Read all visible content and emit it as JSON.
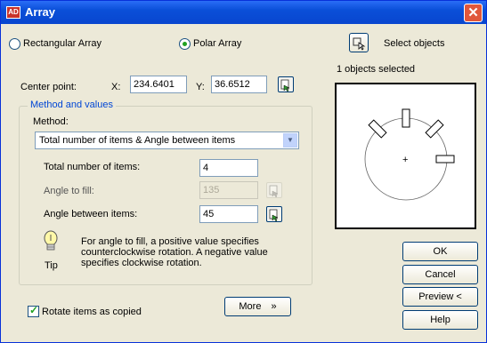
{
  "window": {
    "app_icon_text": "AD",
    "title": "Array",
    "close_symbol": "✕"
  },
  "array_type": {
    "rectangular_label": "Rectangular Array",
    "polar_label": "Polar Array",
    "selected": "Polar Array"
  },
  "center_point": {
    "label": "Center point:",
    "x_label": "X:",
    "x_value": "234.6401",
    "y_label": "Y:",
    "y_value": "36.6512"
  },
  "method_values": {
    "legend": "Method and values",
    "method_label": "Method:",
    "method_value": "Total number of items & Angle between items",
    "total_items_label": "Total number of items:",
    "total_items_value": "4",
    "angle_fill_label": "Angle to fill:",
    "angle_fill_value": "135",
    "angle_between_label": "Angle between items:",
    "angle_between_value": "45",
    "tip_text": "For angle to fill, a positive value specifies counterclockwise rotation.  A negative value specifies clockwise rotation.",
    "tip_label": "Tip"
  },
  "options": {
    "rotate_label": "Rotate items as copied",
    "rotate_checked": true,
    "more_label": "More",
    "more_chevron": "»"
  },
  "selection": {
    "select_objects_label": "Select objects",
    "count_text": "1 objects selected"
  },
  "buttons": {
    "ok": "OK",
    "cancel": "Cancel",
    "preview": "Preview <",
    "help": "Help"
  },
  "icons": {
    "pick_point": "pick-point-icon",
    "select_objects": "select-objects-icon",
    "lightbulb": "lightbulb-icon"
  },
  "colors": {
    "titlebar": "#0a4fd8",
    "dialog_bg": "#ece9d8",
    "radio_dot": "#21a121",
    "group_legend": "#0046d5",
    "close": "#e0573b"
  }
}
